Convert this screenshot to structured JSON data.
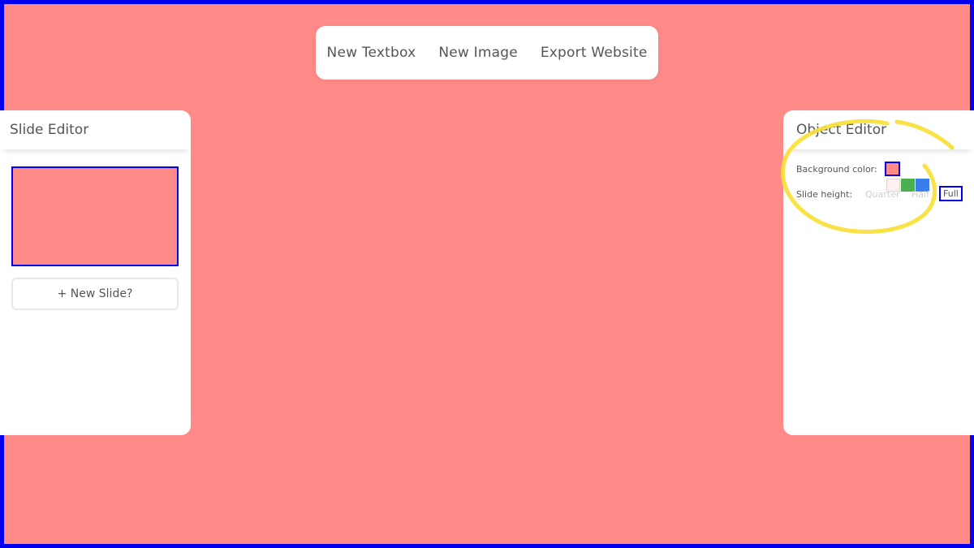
{
  "toolbar": {
    "buttons": [
      {
        "label": "New Textbox"
      },
      {
        "label": "New Image"
      },
      {
        "label": "Export Website"
      }
    ]
  },
  "slide_editor": {
    "title": "Slide Editor",
    "new_slide_label": "+ New Slide?"
  },
  "object_editor": {
    "title": "Object Editor",
    "background_color_label": "Background color:",
    "slide_height_label": "Slide height:",
    "height_options": [
      "Quarter",
      "Half",
      "Full"
    ],
    "selected_height": "Full",
    "swatch_colors": [
      "#fdf1f1",
      "#4caf50",
      "#3b7dea"
    ],
    "current_background": "#ff8a88"
  },
  "colors": {
    "canvas_background": "#ff8a88",
    "selection_border": "#0000ee",
    "annotation": "#f7e036"
  }
}
